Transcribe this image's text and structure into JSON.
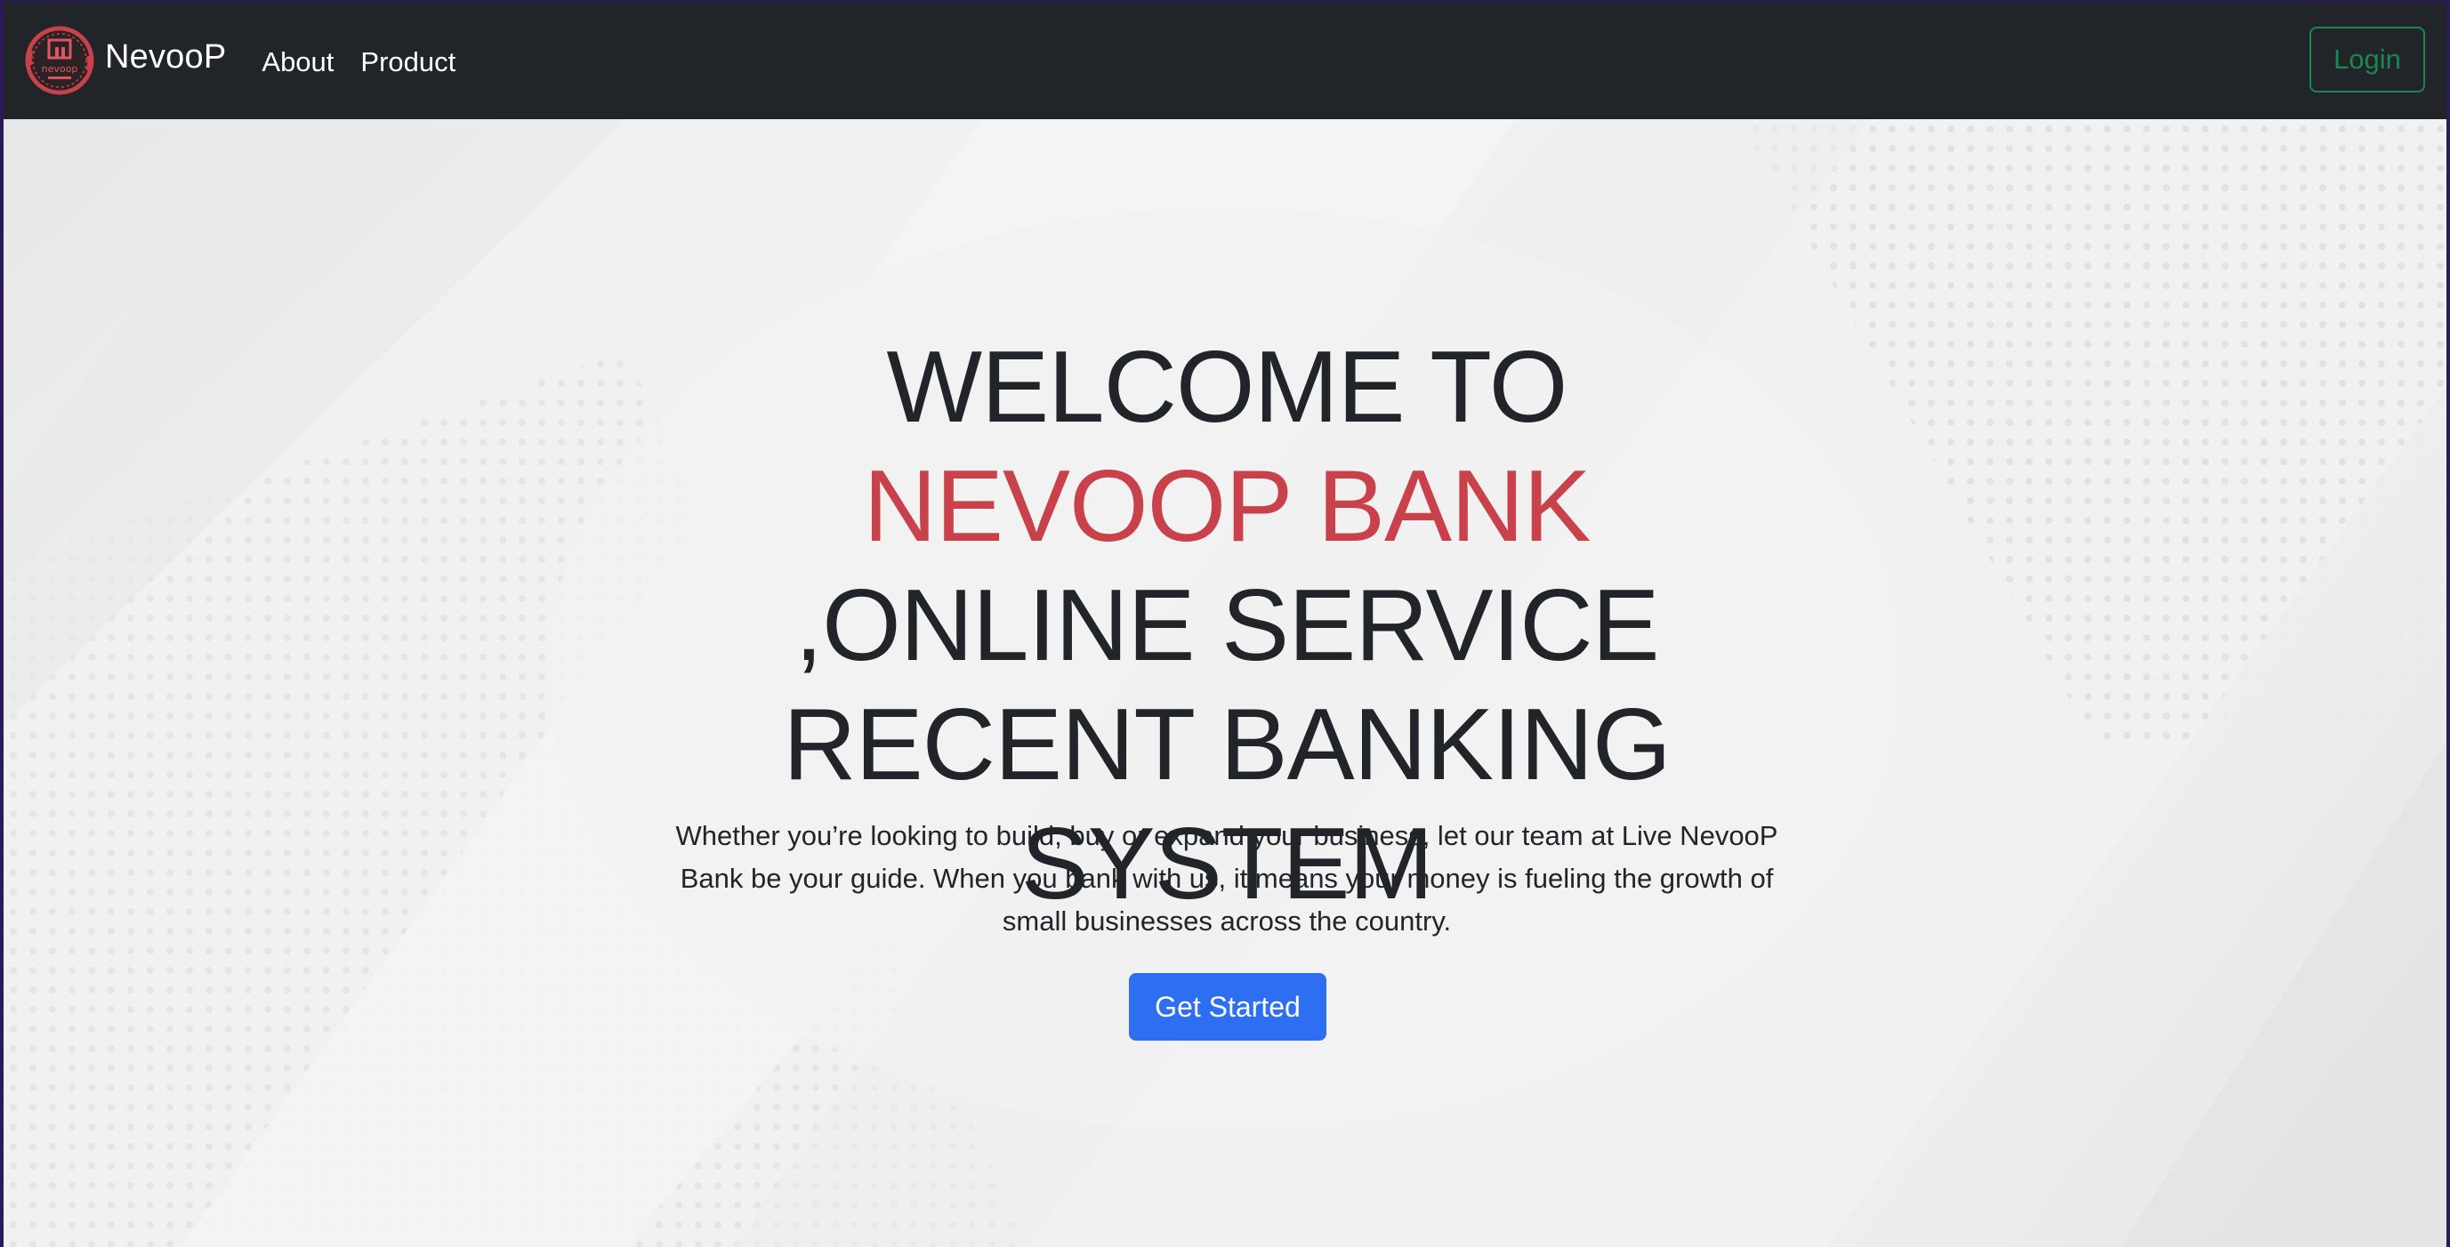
{
  "brand": {
    "name": "NevooP",
    "logo_text": "nevoop",
    "logo_icon": "bank-building-icon"
  },
  "nav": {
    "items": [
      {
        "label": "About"
      },
      {
        "label": "Product"
      }
    ],
    "login_label": "Login"
  },
  "hero": {
    "headline_part1": "WELCOME TO ",
    "headline_accent": "NEVOOP BANK",
    "headline_part2": " ,ONLINE SERVICE RECENT BANKING SYSTEM",
    "description": "Whether you’re looking to build, buy or expand your business, let our team at Live NevooP Bank be your guide. When you bank with us, it means your money is fueling the growth of small businesses across the country.",
    "cta_label": "Get Started"
  },
  "colors": {
    "navbar_bg": "#212529",
    "accent_red": "#c8414b",
    "login_green": "#198754",
    "cta_blue": "#2e6ef3",
    "hero_bg": "#f1f1f1"
  }
}
